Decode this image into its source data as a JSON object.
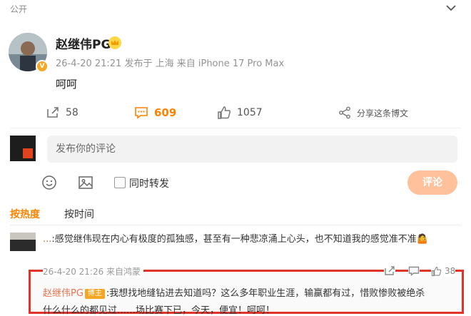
{
  "post": {
    "visibility": "公开",
    "author": "赵继伟PG",
    "verified_badge": "V",
    "meta": "26-4-20 21:21  发布于 上海  来自 iPhone 17 Pro Max",
    "text": "呵呵",
    "actions": {
      "repost_count": "58",
      "comment_count": "609",
      "like_count": "1057",
      "share_label": "分享这条博文"
    }
  },
  "composer": {
    "placeholder": "发布你的评论",
    "repost_label": "同时转发",
    "submit_label": "评论",
    "submit_color": "#ffc09c"
  },
  "sort_tabs": {
    "hot": "按热度",
    "time": "按时间",
    "active_color": "#ff8200"
  },
  "comments": [
    {
      "prefix": "...",
      "text": ":感觉继伟现在内心有极度的孤独感，甚至有一种悲凉涌上心头，也不知道我的感觉准不准🤷",
      "meta": "26-4-20 21:26  来自鸿蒙",
      "like_count": "38",
      "reply": {
        "user": "赵继伟PG",
        "tag": "博主",
        "text": ":我想找地缝钻进去知道吗？这么多年职业生涯，输赢都有过，惜败惨败被绝杀",
        "line2": "什么什么的都见过……场比赛下已，今天，便宜！呵呵！"
      }
    }
  ],
  "icons": [
    "chevron-down-icon",
    "crown-icon",
    "repost-icon",
    "comment-icon",
    "like-icon",
    "share-icon",
    "emoji-icon",
    "image-icon"
  ]
}
